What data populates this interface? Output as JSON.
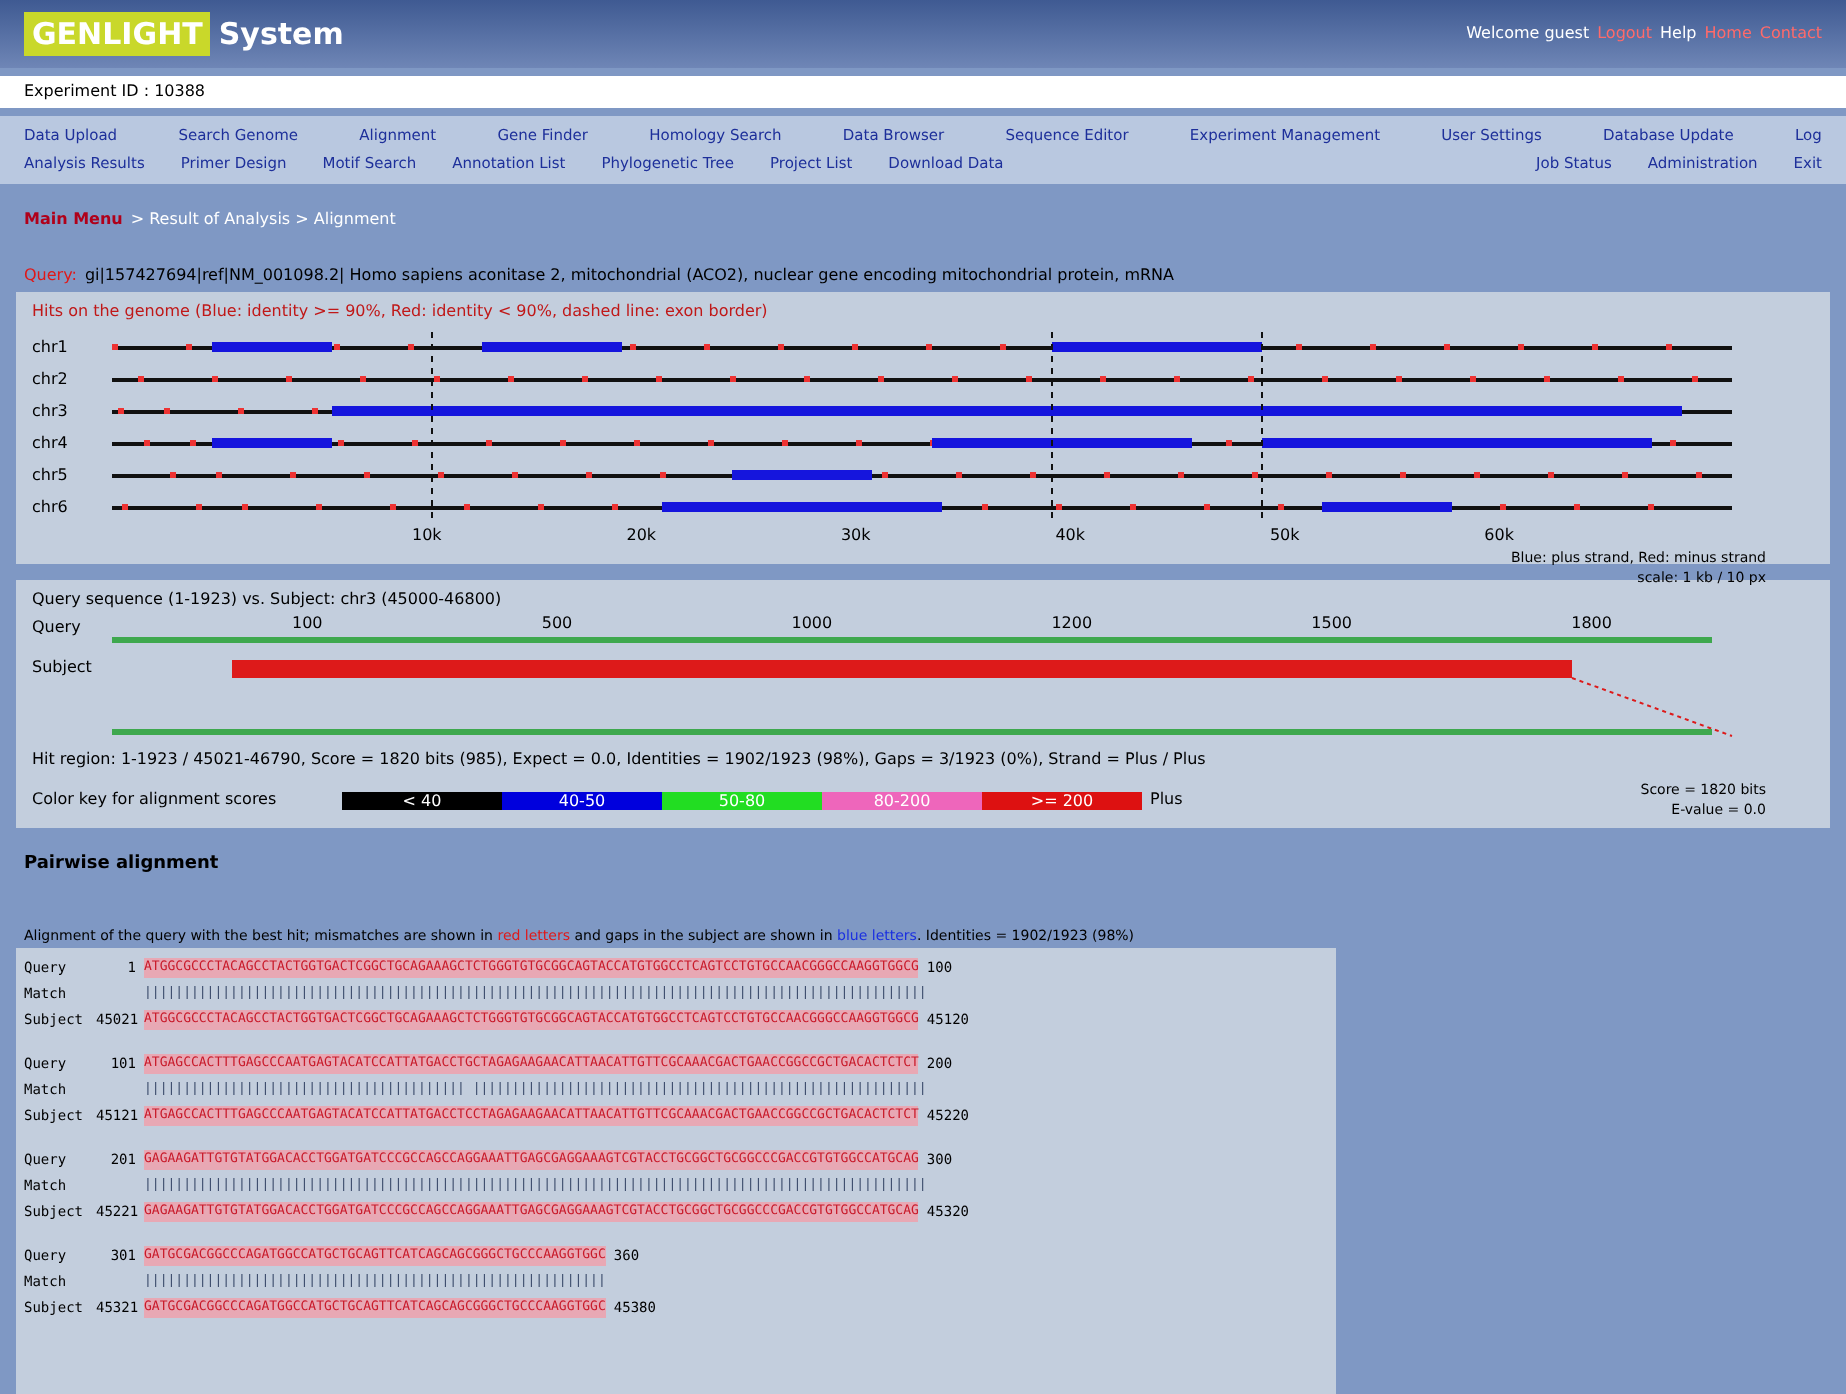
{
  "header": {
    "logo_mark": "GENLIGHT",
    "logo_text": "System",
    "links": [
      {
        "text": "Welcome guest",
        "kind": "text"
      },
      {
        "text": "Logout",
        "kind": "link"
      },
      {
        "text": "Help",
        "kind": "text"
      },
      {
        "text": "Home",
        "kind": "link"
      },
      {
        "text": "Contact",
        "kind": "link"
      }
    ]
  },
  "info_bar": "Experiment ID : 10388",
  "menu": {
    "row_1": [
      "Data Upload",
      "Search Genome",
      "Alignment",
      "Gene Finder",
      "Homology Search",
      "Data Browser",
      "Sequence Editor",
      "Experiment Management",
      "User Settings",
      "Database Update",
      "Log"
    ],
    "row_2_left": [
      "Analysis Results",
      "Primer Design",
      "Motif Search",
      "Annotation List",
      "Phylogenetic Tree",
      "Project List",
      "Download Data"
    ],
    "row_2_right": [
      "Job Status",
      "Administration",
      "Exit"
    ]
  },
  "breadcrumb": {
    "link": "Main Menu",
    "text": "> Result of Analysis > Alignment"
  },
  "query": {
    "label": "Query:",
    "text": "gi|157427694|ref|NM_001098.2| Homo sapiens aconitase 2, mitochondrial (ACO2), nuclear gene encoding mitochondrial protein, mRNA"
  },
  "tracks_panel": {
    "caption": "Hits on the genome (Blue: identity >= 90%, Red: identity < 90%, dashed line: exon border)",
    "track_labels": [
      "chr1",
      "chr2",
      "chr3",
      "chr4",
      "chr5",
      "chr6"
    ],
    "ticks": [
      "10k",
      "20k",
      "30k",
      "40k",
      "50k",
      "60k"
    ],
    "legend": [
      "Blue: plus strand, Red: minus strand",
      "scale: 1 kb / 10 px"
    ]
  },
  "detail_panel": {
    "caption": "Query sequence (1-1923) vs. Subject: chr3 (45000-46800)",
    "labels": [
      "Query",
      "Subject"
    ],
    "ticks": [
      "100",
      "500",
      "1000",
      "1200",
      "1500",
      "1800"
    ],
    "score_line": "Hit region: 1-1923 / 45021-46790, Score = 1820 bits (985), Expect = 0.0, Identities = 1902/1923 (98%), Gaps = 3/1923 (0%), Strand = Plus / Plus",
    "legend_label": "Color key for alignment scores",
    "legend": [
      {
        "text": "< 40",
        "color": "#000000"
      },
      {
        "text": "40-50",
        "color": "#0000dd"
      },
      {
        "text": "50-80",
        "color": "#22dd22"
      },
      {
        "text": "80-200",
        "color": "#ee66bb"
      },
      {
        "text": ">= 200",
        "color": "#dd1111"
      }
    ],
    "legend_after": "Plus",
    "summary": [
      "Score = 1820 bits",
      "E-value = 0.0"
    ]
  },
  "alignment": {
    "heading": "Pairwise alignment",
    "description_start": "Alignment of the query with the best hit; mismatches are shown in",
    "description_red": "red letters",
    "description_middle": "and gaps in the subject are shown in",
    "description_blue": "blue letters",
    "description_end": ". Identities = 1902/1923 (98%)",
    "blocks": [
      {
        "rows": [
          {
            "label": "Query",
            "start": "1",
            "seq": "ATGGCGCCCTACAGCCTACTGGTGACTCGGCTGCAGAAAGCTCTGGGTGTGCGGCAGTACCATGTGGCCTCAGTCCTGTGCCAACGGGCCAAGGTGGCG",
            "end": "100"
          },
          {
            "label": "Match",
            "start": "",
            "seq": "||||||||||||||||||||||||||||||||||||||||||||||||||||||||||||||||||||||||||||||||||||||||||||||||||||",
            "end": ""
          },
          {
            "label": "Subject",
            "start": "45021",
            "seq": "ATGGCGCCCTACAGCCTACTGGTGACTCGGCTGCAGAAAGCTCTGGGTGTGCGGCAGTACCATGTGGCCTCAGTCCTGTGCCAACGGGCCAAGGTGGCG",
            "end": "45120"
          }
        ]
      },
      {
        "rows": [
          {
            "label": "Query",
            "start": "101",
            "seq": "ATGAGCCACTTTGAGCCCAATGAGTACATCCATTATGACCTGCTAGAGAAGAACATTAACATTGTTCGCAAACGACTGAACCGGCCGCTGACACTCTCT",
            "end": "200"
          },
          {
            "label": "Match",
            "start": "",
            "seq": "||||||||||||||||||||||||||||||||||||||||| ||||||||||||||||||||||||||||||||||||||||||||||||||||||||||",
            "end": ""
          },
          {
            "label": "Subject",
            "start": "45121",
            "seq": "ATGAGCCACTTTGAGCCCAATGAGTACATCCATTATGACCTCCTAGAGAAGAACATTAACATTGTTCGCAAACGACTGAACCGGCCGCTGACACTCTCT",
            "end": "45220"
          }
        ]
      },
      {
        "rows": [
          {
            "label": "Query",
            "start": "201",
            "seq": "GAGAAGATTGTGTATGGACACCTGGATGATCCCGCCAGCCAGGAAATTGAGCGAGGAAAGTCGTACCTGCGGCTGCGGCCCGACCGTGTGGCCATGCAG",
            "end": "300"
          },
          {
            "label": "Match",
            "start": "",
            "seq": "||||||||||||||||||||||||||||||||||||||||||||||||||||||||||||||||||||||||||||||||||||||||||||||||||||",
            "end": ""
          },
          {
            "label": "Subject",
            "start": "45221",
            "seq": "GAGAAGATTGTGTATGGACACCTGGATGATCCCGCCAGCCAGGAAATTGAGCGAGGAAAGTCGTACCTGCGGCTGCGGCCCGACCGTGTGGCCATGCAG",
            "end": "45320"
          }
        ]
      },
      {
        "rows": [
          {
            "label": "Query",
            "start": "301",
            "seq": "GATGCGACGGCCCAGATGGCCATGCTGCAGTTCATCAGCAGCGGGCTGCCCAAGGTGGC",
            "end": "360"
          },
          {
            "label": "Match",
            "start": "",
            "seq": "|||||||||||||||||||||||||||||||||||||||||||||||||||||||||||",
            "end": ""
          },
          {
            "label": "Subject",
            "start": "45321",
            "seq": "GATGCGACGGCCCAGATGGCCATGCTGCAGTTCATCAGCAGCGGGCTGCCCAAGGTGGC",
            "end": "45380"
          }
        ]
      }
    ]
  }
}
